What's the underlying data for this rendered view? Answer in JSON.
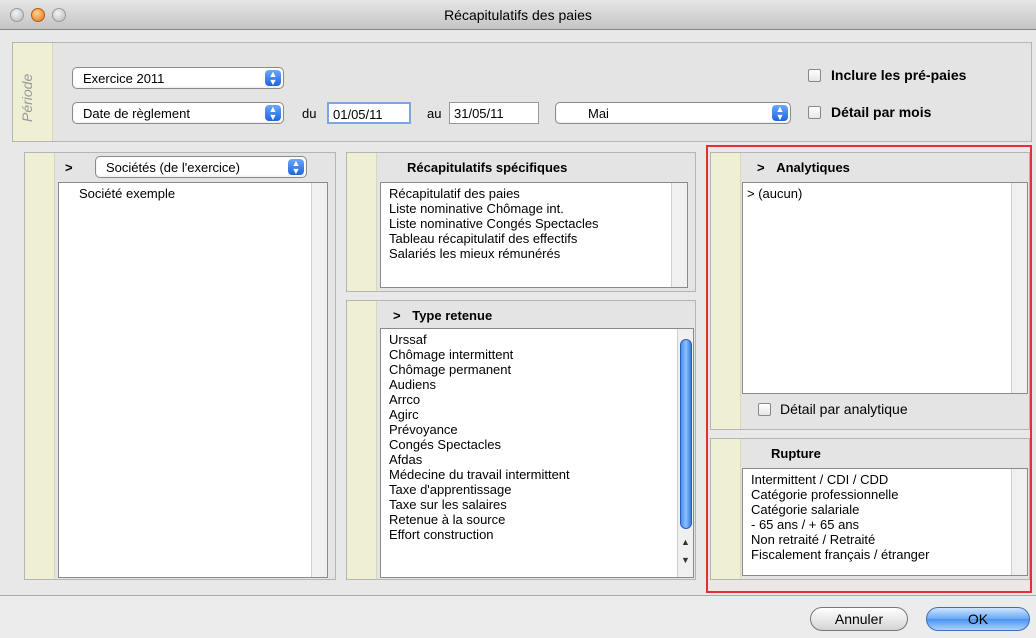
{
  "window": {
    "title": "Récapitulatifs des paies"
  },
  "period": {
    "label": "Période",
    "exercice": "Exercice 2011",
    "date_type": "Date de règlement",
    "du_label": "du",
    "du_value": "01/05/11",
    "au_label": "au",
    "au_value": "31/05/11",
    "month": "Mai",
    "include_prepaies": "Inclure les pré-paies",
    "detail_month": "Détail par mois"
  },
  "companies": {
    "chevron": ">",
    "selector": "Sociétés (de l'exercice)",
    "items": [
      "Société exemple"
    ]
  },
  "specific": {
    "title": "Récapitulatifs spécifiques",
    "items": [
      "Récapitulatif des paies",
      "Liste nominative Chômage int.",
      "Liste nominative Congés Spectacles",
      "Tableau récapitulatif des effectifs",
      "Salariés les mieux rémunérés"
    ]
  },
  "retenue": {
    "title": "Type retenue",
    "chevron": ">",
    "items": [
      "Urssaf",
      "Chômage intermittent",
      "Chômage permanent",
      "Audiens",
      "Arrco",
      "Agirc",
      "Prévoyance",
      "Congés Spectacles",
      "Afdas",
      "Médecine du travail intermittent",
      "Taxe d'apprentissage",
      "Taxe sur les salaires",
      "Retenue à la source",
      "Effort construction"
    ]
  },
  "analytiques": {
    "title": "Analytiques",
    "chevron": ">",
    "items": [
      "> (aucun)"
    ],
    "detail": "Détail par analytique"
  },
  "rupture": {
    "title": "Rupture",
    "items": [
      "Intermittent / CDI / CDD",
      "Catégorie professionnelle",
      "Catégorie salariale",
      "- 65 ans / + 65 ans",
      "Non retraité / Retraité",
      "Fiscalement français / étranger"
    ]
  },
  "buttons": {
    "cancel": "Annuler",
    "ok": "OK"
  }
}
